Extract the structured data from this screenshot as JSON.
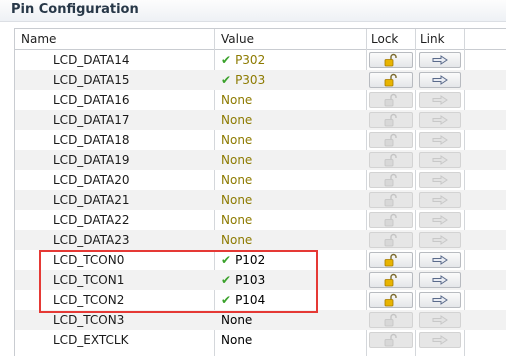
{
  "panel": {
    "title": "Pin Configuration"
  },
  "table": {
    "columns": {
      "name": "Name",
      "value": "Value",
      "lock": "Lock",
      "link": "Link"
    },
    "rows": [
      {
        "name": "LCD_DATA14",
        "value": "P302",
        "assigned": true
      },
      {
        "name": "LCD_DATA15",
        "value": "P303",
        "assigned": true
      },
      {
        "name": "LCD_DATA16",
        "value": "None",
        "assigned": false
      },
      {
        "name": "LCD_DATA17",
        "value": "None",
        "assigned": false
      },
      {
        "name": "LCD_DATA18",
        "value": "None",
        "assigned": false
      },
      {
        "name": "LCD_DATA19",
        "value": "None",
        "assigned": false
      },
      {
        "name": "LCD_DATA20",
        "value": "None",
        "assigned": false
      },
      {
        "name": "LCD_DATA21",
        "value": "None",
        "assigned": false
      },
      {
        "name": "LCD_DATA22",
        "value": "None",
        "assigned": false
      },
      {
        "name": "LCD_DATA23",
        "value": "None",
        "assigned": false
      },
      {
        "name": "LCD_TCON0",
        "value": "P102",
        "assigned": true
      },
      {
        "name": "LCD_TCON1",
        "value": "P103",
        "assigned": true
      },
      {
        "name": "LCD_TCON2",
        "value": "P104",
        "assigned": true
      },
      {
        "name": "LCD_TCON3",
        "value": "None",
        "assigned": false
      },
      {
        "name": "LCD_EXTCLK",
        "value": "None",
        "assigned": false
      }
    ]
  },
  "colors": {
    "highlight": "#e53935",
    "check": "#3aa12b",
    "lock_icon": "#d9a400"
  },
  "icons": {
    "check": "check-icon",
    "lock": "unlocked-padlock-icon",
    "link": "right-arrow-icon"
  }
}
